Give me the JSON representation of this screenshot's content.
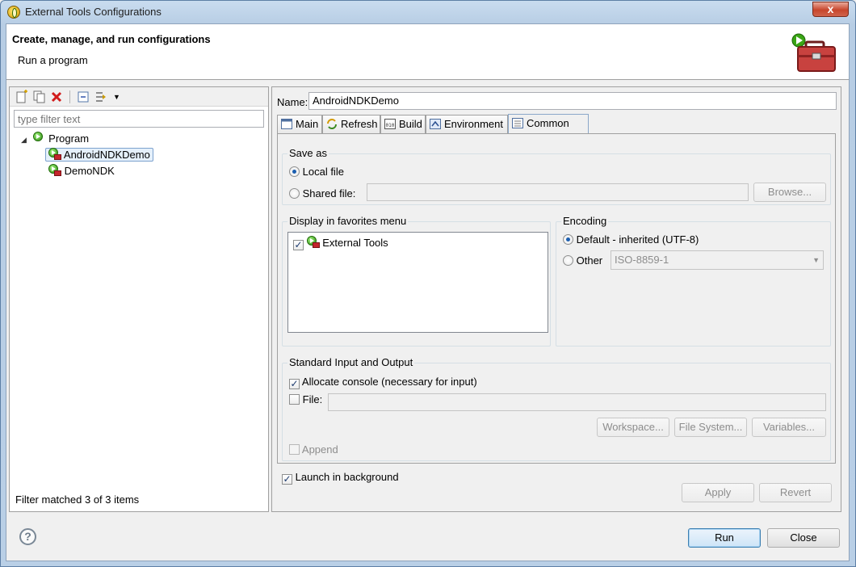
{
  "window": {
    "title": "External Tools Configurations",
    "close_glyph": "x"
  },
  "header": {
    "title": "Create, manage, and run configurations",
    "description": "Run a program",
    "icon": "toolbox-run-icon"
  },
  "left": {
    "toolbar": {
      "new_icon": "new-config-icon",
      "duplicate_icon": "duplicate-icon",
      "delete_icon": "delete-icon",
      "collapse_icon": "collapse-all-icon",
      "filter_icon": "filter-icon"
    },
    "filter_placeholder": "type filter text",
    "tree": {
      "category": "Program",
      "items": [
        "AndroidNDKDemo",
        "DemoNDK"
      ],
      "selected": "AndroidNDKDemo"
    },
    "status": "Filter matched 3 of 3 items"
  },
  "right": {
    "name_label": "Name:",
    "name_value": "AndroidNDKDemo",
    "tabs": [
      {
        "label": "Main",
        "icon": "main-tab-icon"
      },
      {
        "label": "Refresh",
        "icon": "refresh-icon"
      },
      {
        "label": "Build",
        "icon": "build-icon"
      },
      {
        "label": "Environment",
        "icon": "environment-icon"
      },
      {
        "label": "Common",
        "icon": "common-icon"
      }
    ],
    "active_tab": "Common",
    "save_as": {
      "label": "Save as",
      "local": "Local file",
      "shared": "Shared file:",
      "browse": "Browse..."
    },
    "favorites": {
      "label": "Display in favorites menu",
      "items": [
        "External Tools"
      ]
    },
    "encoding": {
      "label": "Encoding",
      "default": "Default - inherited (UTF-8)",
      "other": "Other",
      "other_value": "ISO-8859-1"
    },
    "stdio": {
      "label": "Standard Input and Output",
      "allocate": "Allocate console (necessary for input)",
      "file": "File:",
      "workspace": "Workspace...",
      "filesystem": "File System...",
      "variables": "Variables...",
      "append": "Append"
    },
    "launch_bg": "Launch in background",
    "apply": "Apply",
    "revert": "Revert"
  },
  "footer": {
    "help_glyph": "?",
    "run": "Run",
    "close": "Close"
  }
}
